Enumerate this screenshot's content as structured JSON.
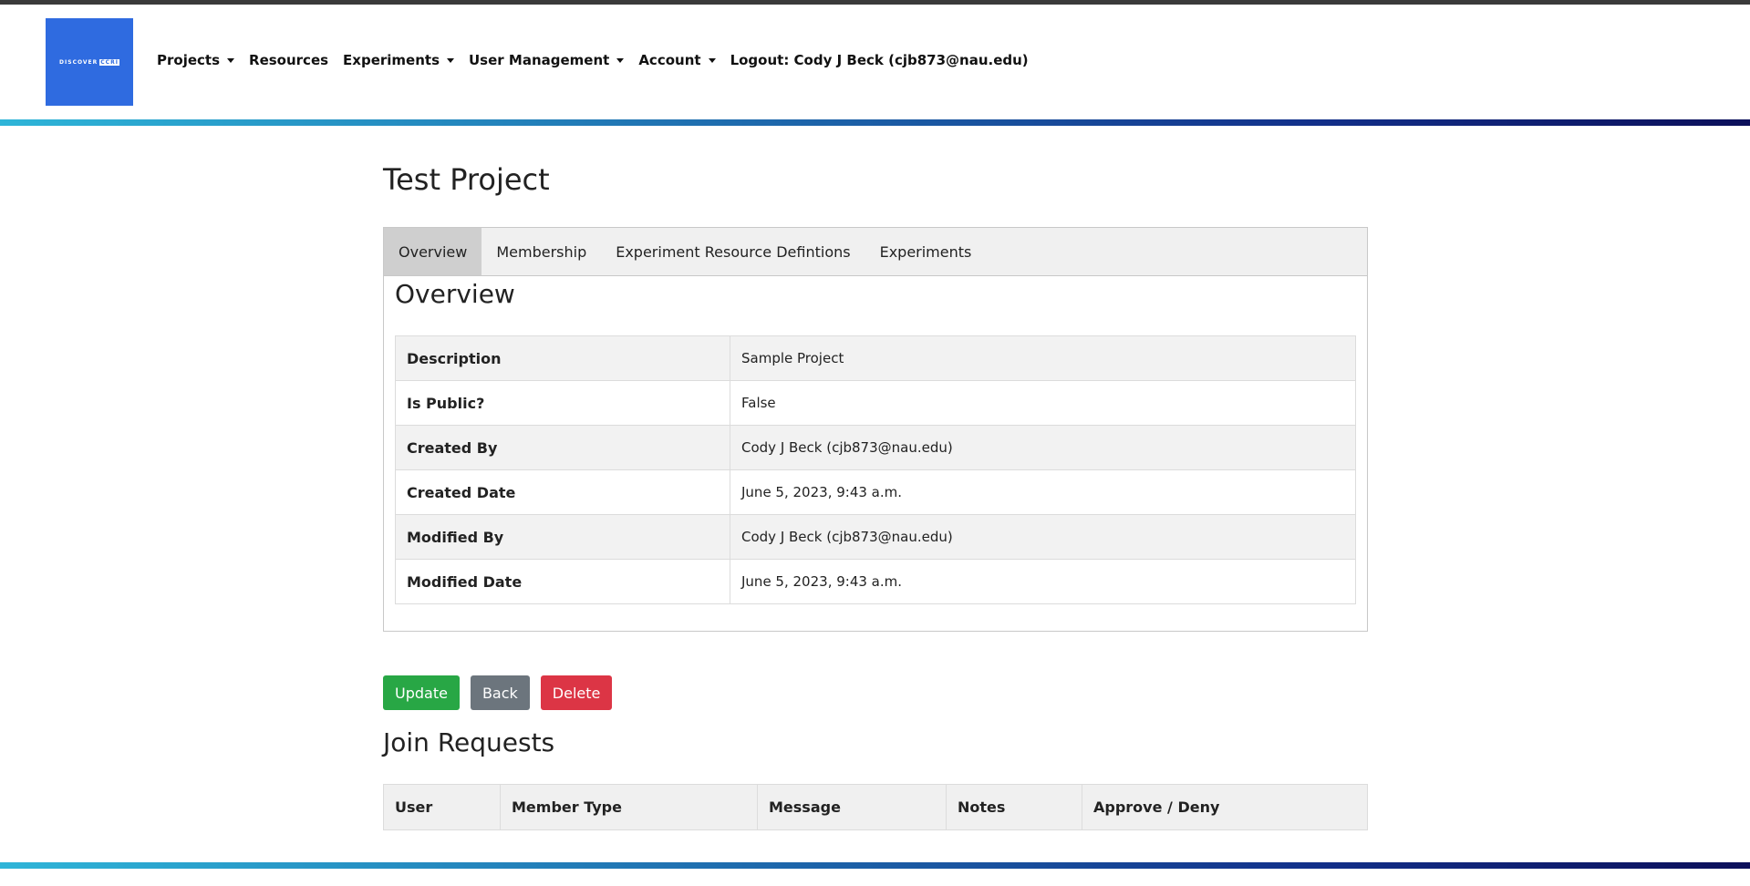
{
  "header": {
    "logo_text": "DISCOVER",
    "logo_mark": "CCRI",
    "nav": [
      {
        "label": "Projects",
        "dropdown": true
      },
      {
        "label": "Resources",
        "dropdown": false
      },
      {
        "label": "Experiments",
        "dropdown": true
      },
      {
        "label": "User Management",
        "dropdown": true
      },
      {
        "label": "Account",
        "dropdown": true
      },
      {
        "label": "Logout: Cody J Beck (cjb873@nau.edu)",
        "dropdown": false
      }
    ]
  },
  "page": {
    "title": "Test Project"
  },
  "tabs": [
    {
      "label": "Overview",
      "active": true
    },
    {
      "label": "Membership",
      "active": false
    },
    {
      "label": "Experiment Resource Defintions",
      "active": false
    },
    {
      "label": "Experiments",
      "active": false
    }
  ],
  "overview": {
    "title": "Overview",
    "rows": [
      {
        "key": "Description",
        "value": "Sample Project"
      },
      {
        "key": "Is Public?",
        "value": "False"
      },
      {
        "key": "Created By",
        "value": "Cody J Beck (cjb873@nau.edu)"
      },
      {
        "key": "Created Date",
        "value": "June 5, 2023, 9:43 a.m."
      },
      {
        "key": "Modified By",
        "value": "Cody J Beck (cjb873@nau.edu)"
      },
      {
        "key": "Modified Date",
        "value": "June 5, 2023, 9:43 a.m."
      }
    ]
  },
  "actions": {
    "update_label": "Update",
    "back_label": "Back",
    "delete_label": "Delete"
  },
  "join_requests": {
    "title": "Join Requests",
    "columns": [
      "User",
      "Member Type",
      "Message",
      "Notes",
      "Approve / Deny"
    ]
  },
  "colors": {
    "logo": "#2f6be0",
    "update": "#28a745",
    "back": "#6c757d",
    "delete": "#dc3545"
  }
}
